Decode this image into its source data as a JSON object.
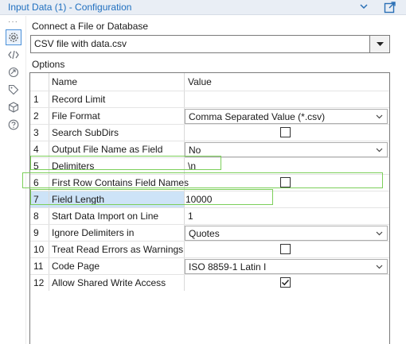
{
  "titlebar": {
    "title": "Input Data (1) - Configuration",
    "collapse_icon": "chevron-down-icon",
    "dock_icon": "undock-icon"
  },
  "rail": {
    "items": [
      {
        "icon": "gear-icon",
        "active": true
      },
      {
        "icon": "code-icon",
        "active": false
      },
      {
        "icon": "connection-icon",
        "active": false
      },
      {
        "icon": "tag-icon",
        "active": false
      },
      {
        "icon": "cube-icon",
        "active": false
      },
      {
        "icon": "help-icon",
        "active": false
      }
    ]
  },
  "connect": {
    "label": "Connect a File or Database",
    "value": "CSV file with data.csv"
  },
  "options": {
    "label": "Options",
    "col_name": "Name",
    "col_value": "Value",
    "rows": [
      {
        "num": "1",
        "name": "Record Limit",
        "value": "",
        "kind": "text"
      },
      {
        "num": "2",
        "name": "File Format",
        "value": "Comma Separated Value (*.csv)",
        "kind": "combo"
      },
      {
        "num": "3",
        "name": "Search SubDirs",
        "value": "",
        "kind": "checkbox",
        "checked": false
      },
      {
        "num": "4",
        "name": "Output File Name as Field",
        "value": "No",
        "kind": "combo"
      },
      {
        "num": "5",
        "name": "Delimiters",
        "value": "\\n",
        "kind": "text"
      },
      {
        "num": "6",
        "name": "First Row Contains Field Names",
        "value": "",
        "kind": "checkbox",
        "checked": false
      },
      {
        "num": "7",
        "name": "Field Length",
        "value": "10000",
        "kind": "input"
      },
      {
        "num": "8",
        "name": "Start Data Import on Line",
        "value": "1",
        "kind": "text"
      },
      {
        "num": "9",
        "name": "Ignore Delimiters in",
        "value": "Quotes",
        "kind": "combo"
      },
      {
        "num": "10",
        "name": "Treat Read Errors as Warnings",
        "value": "",
        "kind": "checkbox",
        "checked": false
      },
      {
        "num": "11",
        "name": "Code Page",
        "value": "ISO 8859-1 Latin I",
        "kind": "combo"
      },
      {
        "num": "12",
        "name": "Allow Shared Write Access",
        "value": "",
        "kind": "checkbox",
        "checked": true
      }
    ]
  },
  "colors": {
    "title": "#1f6fbf",
    "selected_row": "#cde3f7",
    "highlight": "#7ccf5a"
  }
}
